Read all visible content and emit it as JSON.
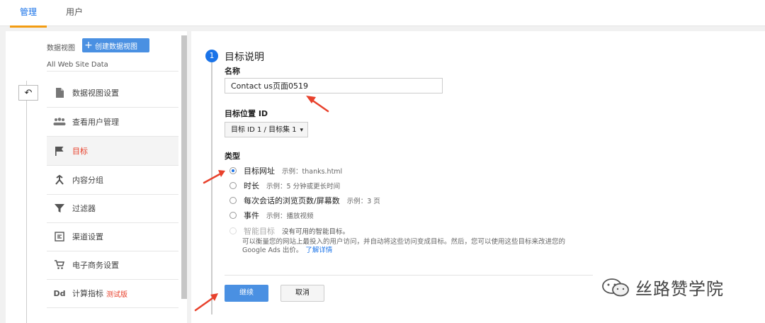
{
  "tabs": [
    {
      "label": "管理"
    },
    {
      "label": "用户"
    }
  ],
  "sidebar": {
    "view_label": "数据视图",
    "create_view_label": "创建数据视图",
    "site_name": "All Web Site Data",
    "items": [
      {
        "label": "数据视图设置",
        "icon": "document-icon"
      },
      {
        "label": "查看用户管理",
        "icon": "users-icon"
      },
      {
        "label": "目标",
        "icon": "flag-icon"
      },
      {
        "label": "内容分组",
        "icon": "content-grouping-icon"
      },
      {
        "label": "过滤器",
        "icon": "filter-icon"
      },
      {
        "label": "渠道设置",
        "icon": "channel-icon"
      },
      {
        "label": "电子商务设置",
        "icon": "cart-icon"
      },
      {
        "label": "计算指标",
        "icon": "dd-icon",
        "badge": "测试版",
        "icon_text": "Dd"
      }
    ]
  },
  "goal": {
    "step_number": "1",
    "section_title": "目标说明",
    "name_label": "名称",
    "name_value": "Contact us页面0519",
    "slot_label": "目标位置 ID",
    "slot_value": "目标 ID 1 / 目标集 1",
    "type_label": "类型",
    "types": [
      {
        "label": "目标网址",
        "example": "示例：thanks.html"
      },
      {
        "label": "时长",
        "example": "示例：5 分钟或更长时间"
      },
      {
        "label": "每次会话的浏览页数/屏幕数",
        "example": "示例：3 页"
      },
      {
        "label": "事件",
        "example": "示例：播放视频"
      },
      {
        "label": "智能目标",
        "example": "没有可用的智能目标。"
      }
    ],
    "smart_desc_line1": "可以衡量您的网站上最投入的用户访问，并自动将这些访问变成目标。然后，您可以使用这些目标来改进您的",
    "smart_desc_line2": "Google Ads 出价。",
    "learn_more": "了解详情",
    "continue_label": "继续",
    "cancel_label": "取消"
  },
  "watermark": {
    "text": "丝路赞学院"
  },
  "colors": {
    "accent": "#1a73e8",
    "tab_underline": "#f39c12",
    "selected": "#e8412c",
    "arrow": "#e8412c"
  }
}
